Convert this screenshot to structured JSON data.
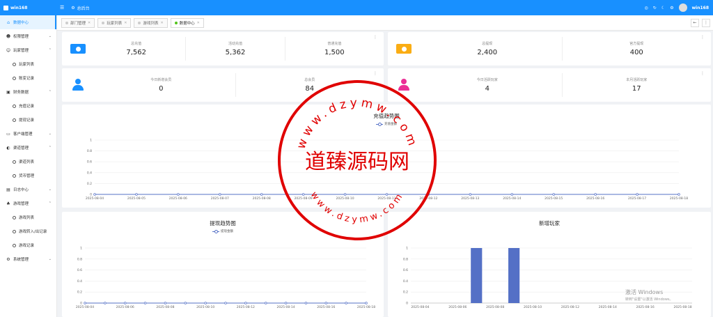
{
  "app": {
    "logo_text": "win168",
    "home_label": "总后台",
    "user_name": "win168"
  },
  "sidebar": {
    "items": [
      {
        "label": "数据中心",
        "icon": "home-icon",
        "active": true,
        "level": 0
      },
      {
        "label": "权限管理",
        "icon": "team-icon",
        "level": 0,
        "arrow": "down"
      },
      {
        "label": "玩家管理",
        "icon": "user-group-icon",
        "level": 0,
        "arrow": "up"
      },
      {
        "label": "玩家列表",
        "level": 1
      },
      {
        "label": "账变记录",
        "level": 1
      },
      {
        "label": "财务数据",
        "icon": "finance-icon",
        "level": 0,
        "arrow": "up"
      },
      {
        "label": "充值记录",
        "level": 1
      },
      {
        "label": "提现记录",
        "level": 1
      },
      {
        "label": "客户端管理",
        "icon": "client-icon",
        "level": 0,
        "arrow": "down"
      },
      {
        "label": "渠道管理",
        "icon": "globe-icon",
        "level": 0,
        "arrow": "up"
      },
      {
        "label": "渠道列表",
        "level": 1
      },
      {
        "label": "货币管理",
        "level": 1
      },
      {
        "label": "日志中心",
        "icon": "log-icon",
        "level": 0,
        "arrow": "down"
      },
      {
        "label": "游戏管理",
        "icon": "game-icon",
        "level": 0,
        "arrow": "up"
      },
      {
        "label": "游戏列表",
        "level": 1
      },
      {
        "label": "游戏转入/出记录",
        "level": 1
      },
      {
        "label": "游戏记录",
        "level": 1
      },
      {
        "label": "系统管理",
        "icon": "gear-icon",
        "level": 0,
        "arrow": "down"
      }
    ]
  },
  "tabs": [
    {
      "label": "部门管理",
      "active": false
    },
    {
      "label": "玩家列表",
      "active": false
    },
    {
      "label": "游戏列表",
      "active": false
    },
    {
      "label": "数据中心",
      "active": true
    }
  ],
  "stats": {
    "recharge": {
      "icon_color": "#1890ff",
      "cols": [
        {
          "label": "总充值",
          "value": "7,562"
        },
        {
          "label": "活动充值",
          "value": "5,362"
        },
        {
          "label": "普通充值",
          "value": "1,500"
        }
      ]
    },
    "withdraw": {
      "icon_color": "#faad14",
      "cols": [
        {
          "label": "总提现",
          "value": "2,400"
        },
        {
          "label": "官方提现",
          "value": "400"
        }
      ]
    },
    "members": {
      "icon_color": "#1890ff",
      "cols": [
        {
          "label": "今日新增会员",
          "value": "0"
        },
        {
          "label": "总会员",
          "value": "84"
        }
      ]
    },
    "players": {
      "icon_color": "#eb2f96",
      "cols": [
        {
          "label": "今日活跃玩家",
          "value": "4"
        },
        {
          "label": "本月活跃玩家",
          "value": "17"
        }
      ]
    }
  },
  "chart_data": [
    {
      "type": "line",
      "title": "充值趋势图",
      "series": [
        {
          "name": "充值金额",
          "values": [
            0,
            0,
            0,
            0,
            0,
            0,
            0,
            0,
            0,
            0,
            0,
            0,
            0,
            0,
            0
          ]
        }
      ],
      "x": [
        "2025-08-04",
        "2025-08-05",
        "2025-08-06",
        "2025-08-07",
        "2025-08-08",
        "2025-08-09",
        "2025-08-10",
        "2025-08-11",
        "2025-08-12",
        "2025-08-13",
        "2025-08-14",
        "2025-08-15",
        "2025-08-16",
        "2025-08-17",
        "2025-08-18"
      ],
      "ylim": [
        0,
        1
      ],
      "yticks": [
        "0",
        "0.2",
        "0.4",
        "0.6",
        "0.8",
        "1"
      ],
      "color": "#5470c6"
    },
    {
      "type": "line",
      "title": "提现趋势图",
      "series": [
        {
          "name": "提现金额",
          "values": [
            0,
            0,
            0,
            0,
            0,
            0,
            0,
            0,
            0,
            0,
            0,
            0,
            0,
            0,
            0
          ]
        }
      ],
      "x": [
        "2025-08-04",
        "2025-08-05",
        "2025-08-06",
        "2025-08-07",
        "2025-08-08",
        "2025-08-09",
        "2025-08-10",
        "2025-08-11",
        "2025-08-12",
        "2025-08-13",
        "2025-08-14",
        "2025-08-15",
        "2025-08-16",
        "2025-08-17",
        "2025-08-18"
      ],
      "xticks_shown": [
        "2025-08-04",
        "2025-08-06",
        "2025-08-08",
        "2025-08-10",
        "2025-08-12",
        "2025-08-14",
        "2025-08-16",
        "2025-08-18"
      ],
      "ylim": [
        0,
        1
      ],
      "yticks": [
        "0",
        "0.2",
        "0.4",
        "0.6",
        "0.8",
        "1"
      ],
      "color": "#5470c6"
    },
    {
      "type": "bar",
      "title": "新增玩家",
      "x": [
        "2025-08-04",
        "2025-08-05",
        "2025-08-06",
        "2025-08-07",
        "2025-08-08",
        "2025-08-09",
        "2025-08-10",
        "2025-08-11",
        "2025-08-12",
        "2025-08-13",
        "2025-08-14",
        "2025-08-15",
        "2025-08-16",
        "2025-08-17",
        "2025-08-18"
      ],
      "xticks_shown": [
        "2025-08-04",
        "2025-08-06",
        "2025-08-08",
        "2025-08-10",
        "2025-08-12",
        "2025-08-14",
        "2025-08-16",
        "2025-08-18"
      ],
      "values": [
        0,
        0,
        0,
        1,
        0,
        1,
        0,
        0,
        0,
        0,
        0,
        0,
        0,
        0,
        0
      ],
      "ylim": [
        0,
        1
      ],
      "yticks": [
        "0",
        "0.2",
        "0.4",
        "0.6",
        "0.8",
        "1"
      ],
      "color": "#5470c6"
    }
  ],
  "watermark": {
    "text": "道臻源码网",
    "ring_text": "www.dzymw.com",
    "color": "#e00000"
  },
  "os_overlay": {
    "title": "激活 Windows",
    "subtitle": "转到\"设置\"以激活 Windows。"
  }
}
